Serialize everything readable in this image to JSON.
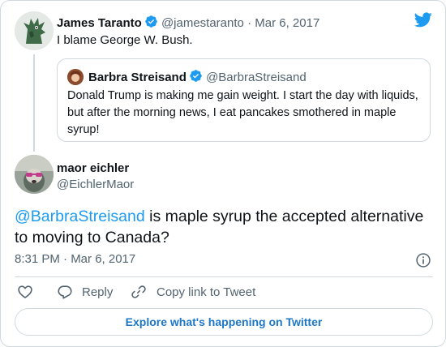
{
  "parent_tweet": {
    "name": "James Taranto",
    "handle": "@jamestaranto",
    "separator": "·",
    "date": "Mar 6, 2017",
    "text": "I blame George W. Bush.",
    "verified": true
  },
  "quoted_tweet": {
    "name": "Barbra Streisand",
    "handle": "@BarbraStreisand",
    "text": "Donald Trump is making me gain weight. I start the day with liquids, but after the morning news, I eat pancakes smothered in maple syrup!",
    "verified": true
  },
  "main_tweet": {
    "name": "maor eichler",
    "handle": "@EichlerMaor",
    "mention": "@BarbraStreisand",
    "text_after_mention": " is maple syrup the accepted alternative to moving to Canada?",
    "timestamp": "8:31 PM · Mar 6, 2017"
  },
  "actions": {
    "reply_label": "Reply",
    "copy_label": "Copy link to Tweet"
  },
  "explore_label": "Explore what's happening on Twitter",
  "icons": [
    "twitter-bird-icon",
    "verified-badge-icon",
    "info-icon",
    "heart-icon",
    "reply-icon",
    "link-icon"
  ],
  "colors": {
    "brand_blue": "#1d9bf0",
    "text": "#0f1419",
    "muted": "#536471",
    "border": "#cfd9de",
    "explore_text": "#1d77c5"
  }
}
